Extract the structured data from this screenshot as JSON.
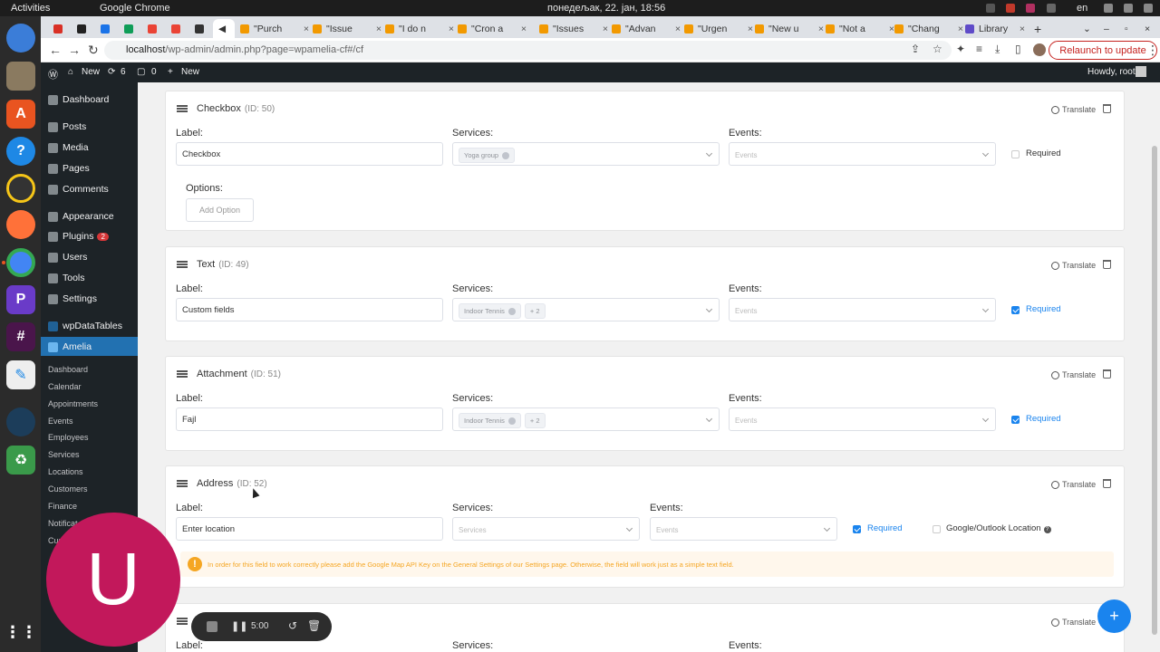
{
  "topbar": {
    "activities": "Activities",
    "app": "Google Chrome",
    "clock": "понедељак, 22. јан, 18:56",
    "lang": "en"
  },
  "tabs": [
    {
      "label": "\"Purch"
    },
    {
      "label": "\"Issue"
    },
    {
      "label": "\"I do n"
    },
    {
      "label": "\"Cron a"
    },
    {
      "label": "\"Issues"
    },
    {
      "label": "\"Advan"
    },
    {
      "label": "\"Urgen"
    },
    {
      "label": "\"New u"
    },
    {
      "label": "\"Not a"
    },
    {
      "label": "\"Chang"
    },
    {
      "label": "Library"
    }
  ],
  "omnibox": {
    "host": "localhost",
    "path": "/wp-admin/admin.php?page=wpamelia-cf#/cf",
    "relaunch": "Relaunch to update"
  },
  "adminbar": {
    "home": "New",
    "updates": "6",
    "comments": "0",
    "new": "New",
    "howdy": "Howdy, root"
  },
  "sidebar": {
    "dashboard": "Dashboard",
    "posts": "Posts",
    "media": "Media",
    "pages": "Pages",
    "comments": "Comments",
    "appearance": "Appearance",
    "plugins": "Plugins",
    "plugins_badge": "2",
    "users": "Users",
    "tools": "Tools",
    "settings": "Settings",
    "wpdatatables": "wpDataTables",
    "amelia": "Amelia",
    "sub": [
      "Dashboard",
      "Calendar",
      "Appointments",
      "Events",
      "Employees",
      "Services",
      "Locations",
      "Customers",
      "Finance",
      "Notificat",
      "Cus"
    ]
  },
  "fields": [
    {
      "title": "Checkbox",
      "id": "(ID: 50)",
      "label_value": "Checkbox",
      "service_tag": "Yoga group",
      "extra": "",
      "required": false,
      "options_label": "Options:",
      "add_option": "Add Option"
    },
    {
      "title": "Text",
      "id": "(ID: 49)",
      "label_value": "Custom fields",
      "service_tag": "Indoor Tennis",
      "extra": "+ 2",
      "required": true
    },
    {
      "title": "Attachment",
      "id": "(ID: 51)",
      "label_value": "Fajl",
      "service_tag": "Indoor Tennis",
      "extra": "+ 2",
      "required": true
    },
    {
      "title": "Address",
      "id": "(ID: 52)",
      "label_value": "Enter location",
      "required": true,
      "google_label": "Google/Outlook Location",
      "warning": "In order for this field to work correctly please add the Google Map API Key on the General Settings of our Settings page. Otherwise, the field will work just as a simple text field."
    }
  ],
  "common": {
    "label": "Label:",
    "services": "Services:",
    "events": "Events:",
    "events_ph": "Events",
    "services_ph": "Services",
    "required": "Required",
    "translate": "Translate"
  },
  "recorder": {
    "time": "5:00"
  },
  "avatar_letter": "U",
  "colors": {
    "accent": "#1a84ee",
    "wp_dark": "#1d2327",
    "wp_blue": "#2271b1",
    "warning": "#f5a623"
  }
}
